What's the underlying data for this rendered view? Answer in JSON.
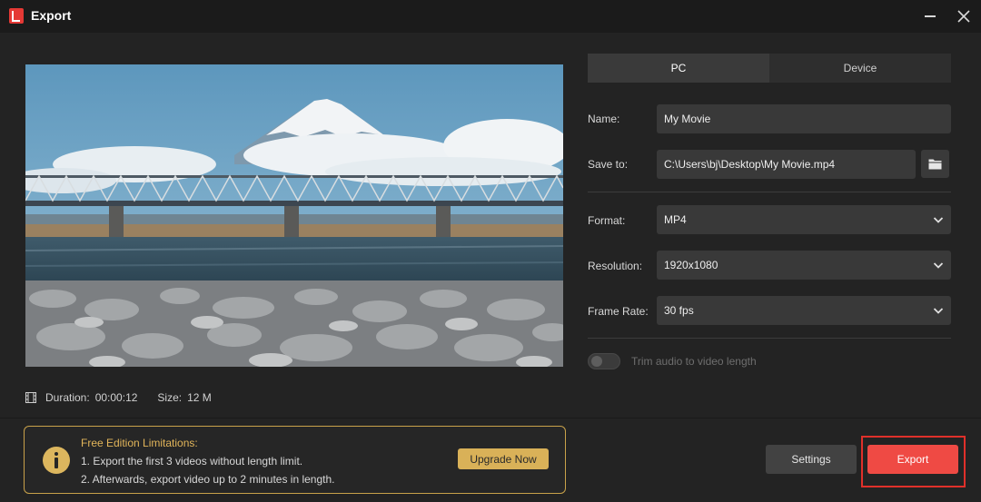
{
  "window": {
    "title": "Export"
  },
  "tabs": [
    {
      "label": "PC",
      "active": true
    },
    {
      "label": "Device",
      "active": false
    }
  ],
  "form": {
    "name": {
      "label": "Name:",
      "value": "My Movie"
    },
    "save_to": {
      "label": "Save to:",
      "value": "C:\\Users\\bj\\Desktop\\My Movie.mp4"
    },
    "format": {
      "label": "Format:",
      "value": "MP4"
    },
    "resolution": {
      "label": "Resolution:",
      "value": "1920x1080"
    },
    "frame_rate": {
      "label": "Frame Rate:",
      "value": "30 fps"
    },
    "trim_audio": {
      "label": "Trim audio to video length",
      "enabled": false
    }
  },
  "preview_info": {
    "duration_label": "Duration:",
    "duration_value": "00:00:12",
    "size_label": "Size:",
    "size_value": "12 M"
  },
  "notice": {
    "title": "Free Edition Limitations:",
    "line1": "1. Export the first 3 videos without length limit.",
    "line2": "2. Afterwards, export video up to 2 minutes in length.",
    "upgrade_label": "Upgrade Now"
  },
  "actions": {
    "settings_label": "Settings",
    "export_label": "Export"
  },
  "colors": {
    "accent": "#ef4a44",
    "warning": "#d9b158",
    "background": "#232323"
  },
  "icons": [
    "app-logo-icon",
    "minimize-icon",
    "close-icon",
    "folder-icon",
    "chevron-down-icon",
    "film-icon",
    "warning-icon"
  ]
}
